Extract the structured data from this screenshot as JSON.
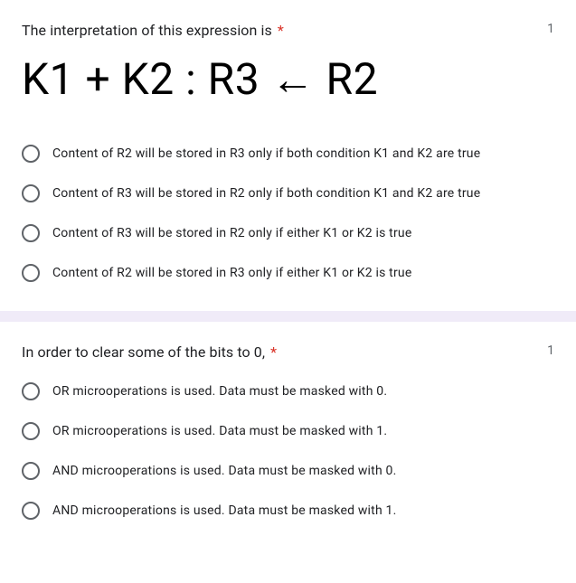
{
  "questions": [
    {
      "title": "The interpretation of this expression is",
      "required": "*",
      "points": "1",
      "expression": "K1 + K2 : R3 ← R2",
      "options": [
        "Content of R2 will be stored in R3 only if both condition K1 and K2 are true",
        "Content of R3 will be stored in R2 only if both condition K1 and K2 are true",
        "Content of R3 will be stored in R2 only if either K1 or K2 is true",
        "Content of R2 will be stored in R3 only if either K1 or K2 is true"
      ]
    },
    {
      "title": "In order to clear some of the bits to 0,",
      "required": "*",
      "points": "1",
      "options": [
        "OR microoperations is used. Data must be masked with 0.",
        "OR microoperations is used. Data must be masked with 1.",
        "AND microoperations is used. Data must be masked with 0.",
        "AND microoperations is used. Data must be masked with 1."
      ]
    }
  ]
}
